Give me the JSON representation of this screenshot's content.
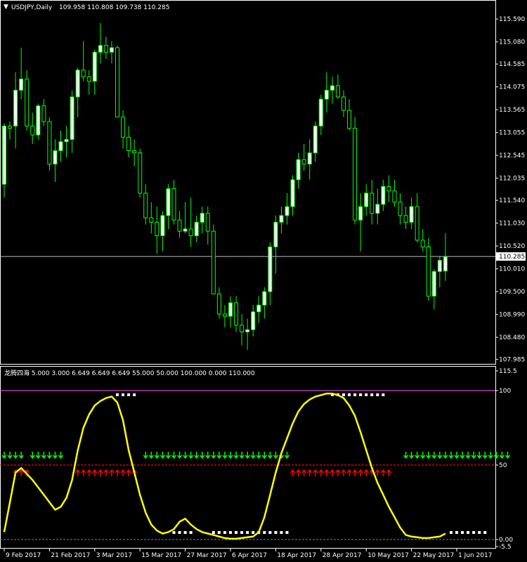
{
  "window": {
    "symbol_menu_glyph": "▼",
    "title": "USDJPY,Daily",
    "ohlc": "109.958 110.808 109.738 110.285"
  },
  "indicator": {
    "title": "龙腾四海 5.000 3.000 6.649 6.649 6.649 55.000 50.000 100.000 0.000 110.000"
  },
  "colors": {
    "background": "#000000",
    "bull_candle": "#ffffff",
    "wick": "#00ff00",
    "bear_candle": "#000000",
    "indicator_line": "#ffff00",
    "buy_arrow": "#00ff00",
    "sell_arrow": "#ff0000",
    "level_50": "#ff0000",
    "level_100": "#ff66ff",
    "marker_dots": "#ffffff",
    "price_line": "#c0c0c0",
    "axis": "#ffffff"
  },
  "chart_data": [
    {
      "type": "candlestick",
      "symbol": "USDJPY",
      "timeframe": "Daily",
      "current_price": 110.285,
      "current_price_label": "110.285",
      "ylim": [
        107.98,
        115.78
      ],
      "yticks": [
        115.59,
        115.08,
        114.585,
        114.075,
        113.565,
        113.055,
        112.545,
        112.035,
        111.54,
        111.03,
        110.52,
        110.01,
        109.5,
        108.99,
        108.48,
        107.985
      ],
      "ytick_labels": [
        "115.590",
        "115.080",
        "114.585",
        "114.075",
        "113.565",
        "113.055",
        "112.545",
        "112.035",
        "111.540",
        "111.030",
        "110.520",
        "110.010",
        "109.500",
        "108.990",
        "108.480",
        "107.985"
      ],
      "xtick_labels": [
        "9 Feb 2017",
        "21 Feb 2017",
        "3 Mar 2017",
        "15 Mar 2017",
        "27 Mar 2017",
        "6 Apr 2017",
        "18 Apr 2017",
        "28 Apr 2017",
        "10 May 2017",
        "22 May 2017",
        "1 Jun 2017"
      ],
      "xtick_index": [
        0,
        8,
        16,
        24,
        32,
        40,
        48,
        56,
        64,
        72,
        80
      ],
      "candles": [
        [
          111.9,
          113.26,
          111.6,
          113.2
        ],
        [
          113.2,
          113.3,
          112.9,
          113.15
        ],
        [
          113.2,
          114.4,
          112.7,
          114.0
        ],
        [
          114.0,
          114.95,
          113.8,
          114.25
        ],
        [
          114.25,
          114.45,
          113.1,
          113.2
        ],
        [
          113.2,
          113.5,
          112.8,
          113.0
        ],
        [
          113.0,
          113.7,
          112.9,
          113.65
        ],
        [
          113.65,
          113.8,
          113.2,
          113.3
        ],
        [
          113.3,
          113.4,
          112.2,
          112.35
        ],
        [
          112.35,
          112.9,
          111.95,
          112.65
        ],
        [
          112.65,
          113.1,
          112.4,
          112.85
        ],
        [
          112.85,
          113.2,
          112.5,
          112.9
        ],
        [
          112.9,
          114.0,
          112.6,
          113.85
        ],
        [
          113.85,
          114.5,
          113.4,
          114.45
        ],
        [
          114.45,
          115.1,
          114.2,
          114.3
        ],
        [
          114.3,
          114.45,
          113.9,
          114.2
        ],
        [
          114.2,
          114.9,
          113.9,
          114.85
        ],
        [
          114.85,
          115.5,
          114.6,
          115.0
        ],
        [
          115.0,
          115.2,
          114.7,
          114.85
        ],
        [
          114.85,
          115.1,
          114.6,
          114.95
        ],
        [
          114.95,
          115.0,
          113.5,
          113.4
        ],
        [
          113.4,
          113.55,
          112.7,
          112.95
        ],
        [
          112.95,
          113.2,
          112.5,
          112.65
        ],
        [
          112.65,
          112.9,
          112.3,
          112.6
        ],
        [
          112.6,
          112.7,
          111.6,
          111.7
        ],
        [
          111.7,
          111.9,
          111.0,
          111.15
        ],
        [
          111.15,
          111.5,
          110.8,
          111.05
        ],
        [
          111.05,
          111.4,
          110.35,
          110.75
        ],
        [
          110.75,
          111.3,
          110.4,
          111.2
        ],
        [
          111.2,
          111.9,
          110.9,
          111.8
        ],
        [
          111.8,
          112.0,
          111.0,
          111.1
        ],
        [
          111.1,
          111.3,
          110.7,
          110.85
        ],
        [
          110.85,
          111.5,
          110.8,
          110.9
        ],
        [
          110.9,
          111.6,
          110.5,
          110.75
        ],
        [
          110.75,
          111.2,
          110.6,
          111.05
        ],
        [
          111.05,
          111.4,
          110.8,
          111.25
        ],
        [
          111.25,
          111.4,
          110.55,
          110.85
        ],
        [
          110.85,
          111.0,
          109.7,
          109.45
        ],
        [
          109.45,
          109.6,
          108.9,
          109.0
        ],
        [
          109.0,
          109.2,
          108.7,
          108.95
        ],
        [
          108.95,
          109.4,
          108.7,
          109.25
        ],
        [
          109.25,
          109.4,
          108.6,
          108.75
        ],
        [
          108.75,
          109.0,
          108.3,
          108.6
        ],
        [
          108.6,
          108.9,
          108.2,
          108.65
        ],
        [
          108.65,
          109.2,
          108.5,
          109.05
        ],
        [
          109.05,
          109.4,
          108.8,
          109.2
        ],
        [
          109.2,
          109.6,
          108.9,
          109.5
        ],
        [
          109.5,
          110.6,
          109.2,
          110.5
        ],
        [
          110.5,
          111.2,
          109.9,
          111.05
        ],
        [
          111.05,
          111.4,
          110.8,
          111.2
        ],
        [
          111.2,
          111.7,
          111.0,
          111.4
        ],
        [
          111.4,
          112.1,
          111.2,
          112.0
        ],
        [
          112.0,
          112.6,
          111.8,
          112.45
        ],
        [
          112.45,
          112.8,
          112.2,
          112.35
        ],
        [
          112.35,
          112.9,
          112.0,
          112.6
        ],
        [
          112.6,
          113.3,
          112.4,
          113.2
        ],
        [
          113.2,
          113.9,
          113.0,
          113.8
        ],
        [
          113.8,
          114.4,
          113.5,
          114.0
        ],
        [
          114.0,
          114.3,
          113.7,
          114.1
        ],
        [
          114.1,
          114.35,
          113.8,
          113.85
        ],
        [
          113.85,
          114.0,
          113.4,
          113.55
        ],
        [
          113.55,
          113.8,
          113.1,
          113.15
        ],
        [
          113.15,
          113.4,
          111.0,
          111.1
        ],
        [
          111.1,
          111.7,
          110.4,
          111.4
        ],
        [
          111.4,
          111.9,
          111.2,
          111.7
        ],
        [
          111.7,
          112.0,
          111.0,
          111.25
        ],
        [
          111.25,
          111.8,
          111.0,
          111.45
        ],
        [
          111.45,
          112.0,
          111.3,
          111.85
        ],
        [
          111.85,
          112.1,
          111.5,
          111.75
        ],
        [
          111.75,
          112.0,
          111.4,
          111.5
        ],
        [
          111.5,
          111.7,
          111.0,
          111.2
        ],
        [
          111.2,
          111.4,
          110.9,
          111.05
        ],
        [
          111.05,
          111.6,
          110.9,
          111.4
        ],
        [
          111.4,
          111.7,
          110.6,
          110.65
        ],
        [
          110.65,
          110.9,
          110.4,
          110.5
        ],
        [
          110.5,
          110.7,
          109.3,
          109.4
        ],
        [
          109.4,
          110.0,
          109.1,
          109.95
        ],
        [
          109.95,
          110.3,
          109.6,
          110.2
        ],
        [
          109.96,
          110.81,
          109.74,
          110.285
        ]
      ]
    },
    {
      "type": "line",
      "name": "龙腾四海",
      "ylim": [
        -3,
        113
      ],
      "yticks": [
        115.5,
        100,
        50,
        0.0,
        -5.5
      ],
      "ytick_labels": [
        "115.5",
        "100",
        "50",
        "0.00",
        "-5.5"
      ],
      "levels": [
        100,
        50,
        0
      ],
      "values": [
        5,
        25,
        45,
        48,
        44,
        40,
        35,
        30,
        25,
        20,
        22,
        28,
        40,
        60,
        75,
        84,
        90,
        93,
        95,
        96,
        92,
        80,
        60,
        45,
        30,
        18,
        10,
        6,
        4,
        5,
        7,
        12,
        14,
        10,
        7,
        5,
        4,
        3,
        2,
        1,
        0.5,
        0.5,
        1,
        1.5,
        2,
        5,
        15,
        30,
        45,
        58,
        68,
        78,
        86,
        91,
        94,
        96,
        97,
        98,
        98,
        97,
        95,
        90,
        83,
        72,
        60,
        48,
        38,
        30,
        22,
        15,
        8,
        3,
        2,
        1.5,
        1,
        1,
        1.5,
        2,
        4
      ],
      "buy_signal_index": [
        0,
        1,
        2,
        3,
        5,
        6,
        7,
        8,
        9,
        10,
        25,
        26,
        27,
        28,
        29,
        30,
        31,
        32,
        33,
        34,
        35,
        36,
        37,
        38,
        39,
        40,
        41,
        42,
        43,
        44,
        45,
        46,
        47,
        48,
        49,
        50,
        71,
        72,
        73,
        74,
        75,
        76,
        77,
        78,
        79,
        80,
        81,
        82,
        83,
        84,
        85,
        86,
        87,
        88,
        89
      ],
      "sell_signal_index": [
        2,
        3,
        4,
        13,
        14,
        15,
        16,
        17,
        18,
        19,
        20,
        21,
        22,
        23,
        51,
        52,
        53,
        54,
        55,
        56,
        57,
        58,
        59,
        60,
        61,
        62,
        63,
        64,
        65,
        66,
        67,
        68
      ],
      "top_marker_index": [
        20,
        21,
        22,
        23,
        58,
        59,
        60,
        61,
        62,
        63,
        64,
        65,
        66,
        67
      ],
      "bottom_marker_index": [
        30,
        31,
        32,
        33,
        37,
        38,
        39,
        40,
        41,
        42,
        43,
        44,
        45,
        46,
        47,
        48,
        49,
        50,
        79,
        80,
        81,
        82,
        83,
        84,
        85
      ]
    }
  ]
}
